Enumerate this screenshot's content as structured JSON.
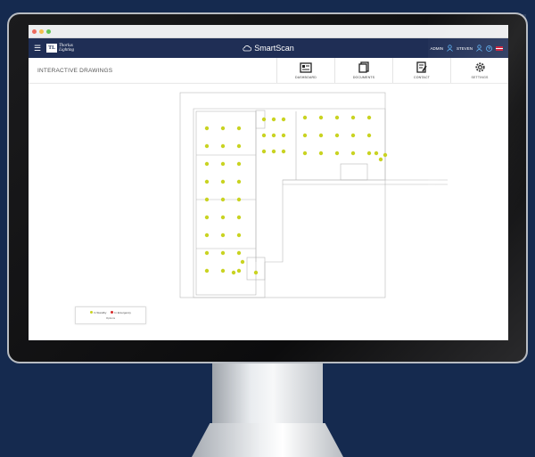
{
  "app": {
    "brand": "SmartScan",
    "logo_mark": "TL",
    "logo_text": "Thorlux Lighting"
  },
  "navbar": {
    "menu_icon": "hamburger-icon",
    "admin_label": "ADMIN",
    "user_label": "STEVEN",
    "help_icon": "help-icon",
    "flag_icon": "uk-flag-icon"
  },
  "page": {
    "title": "INTERACTIVE DRAWINGS"
  },
  "tools": [
    {
      "label": "DASHBOARD",
      "icon": "dashboard-icon"
    },
    {
      "label": "DOCUMENTS",
      "icon": "documents-icon"
    },
    {
      "label": "CONTACT",
      "icon": "contact-icon"
    },
    {
      "label": "SETTINGS",
      "icon": "gear-icon"
    }
  ],
  "legend": {
    "items": [
      {
        "label": "In Standby",
        "color": "#c9d322"
      },
      {
        "label": "In Emergency",
        "color": "#d62b2b"
      }
    ],
    "caption": "Options"
  },
  "colors": {
    "navbar": "#1f2e55",
    "fixture": "#c9d322",
    "background": "#152a4f"
  }
}
